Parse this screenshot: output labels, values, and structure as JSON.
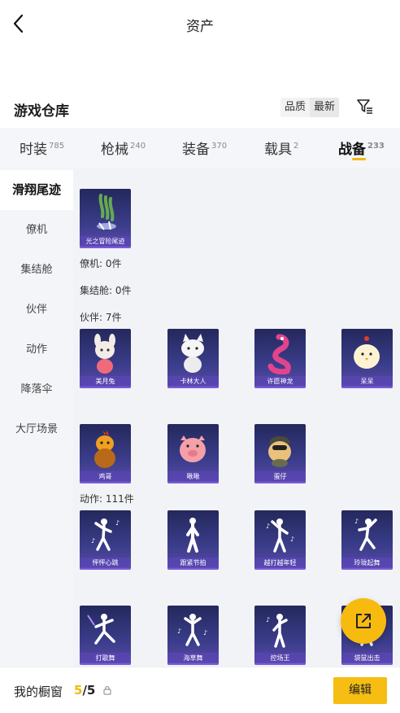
{
  "header": {
    "title": "资产"
  },
  "warehouse": {
    "title": "游戏仓库",
    "sort_quality": "品质",
    "sort_latest": "最新"
  },
  "tabs": [
    {
      "label": "时装",
      "count": "785"
    },
    {
      "label": "枪械",
      "count": "240"
    },
    {
      "label": "装备",
      "count": "370"
    },
    {
      "label": "载具",
      "count": "2"
    },
    {
      "label": "战备",
      "count": "233"
    }
  ],
  "sidebar": {
    "items": [
      {
        "label": "滑翔尾迹"
      },
      {
        "label": "僚机"
      },
      {
        "label": "集结舱"
      },
      {
        "label": "伙伴"
      },
      {
        "label": "动作"
      },
      {
        "label": "降落伞"
      },
      {
        "label": "大厅场景"
      }
    ]
  },
  "content": {
    "glide": {
      "items": [
        {
          "name": "光之冒险尾迹"
        }
      ]
    },
    "wingman_label": "僚机: 0件",
    "capsule_label": "集结舱: 0件",
    "partner_label": "伙伴: 7件",
    "partners": [
      {
        "name": "美月兔"
      },
      {
        "name": "卡林大人"
      },
      {
        "name": "许愿神龙"
      },
      {
        "name": "呆呆"
      },
      {
        "name": "鸡哥"
      },
      {
        "name": "啾啾"
      },
      {
        "name": "蛋仔"
      }
    ],
    "emote_label": "动作: 111件",
    "emotes": [
      {
        "name": "怦怦心跳"
      },
      {
        "name": "跟紧节拍"
      },
      {
        "name": "越打越年轻"
      },
      {
        "name": "玲珑起舞"
      },
      {
        "name": "打歌舞"
      },
      {
        "name": "海草舞"
      },
      {
        "name": "控场王"
      },
      {
        "name": "袋鼠出击"
      }
    ]
  },
  "bottom": {
    "showcase_label": "我的橱窗",
    "showcase_current": "5",
    "showcase_total": "/5",
    "edit_label": "编辑"
  },
  "colors": {
    "accent": "#f6bd12",
    "card_top": "#24285c",
    "card_bottom": "#5b4aa8"
  },
  "icons": [
    "back-icon",
    "filter-icon",
    "lock-icon",
    "share-icon"
  ]
}
